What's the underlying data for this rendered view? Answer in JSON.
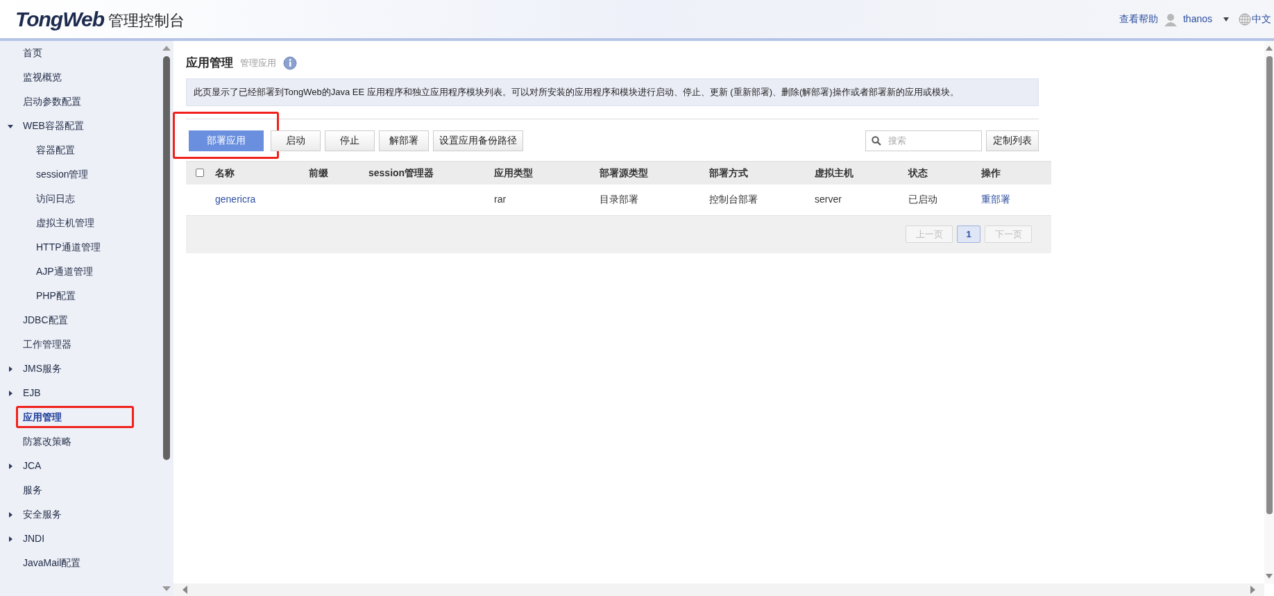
{
  "header": {
    "logo": "TongWeb",
    "title": "管理控制台",
    "help": "查看帮助",
    "user": "thanos",
    "language": "中文"
  },
  "sidebar": {
    "items": [
      {
        "label": "首页",
        "selected": false,
        "highlighted": false
      },
      {
        "label": "监视概览",
        "selected": false,
        "highlighted": false
      },
      {
        "label": "启动参数配置",
        "selected": false,
        "highlighted": false
      },
      {
        "label": "WEB容器配置",
        "selected": false,
        "highlighted": false,
        "expanded": true,
        "children": [
          {
            "label": "容器配置",
            "selected": false,
            "highlighted": false
          },
          {
            "label": "session管理",
            "selected": false,
            "highlighted": false
          },
          {
            "label": "访问日志",
            "selected": false,
            "highlighted": false
          },
          {
            "label": "虚拟主机管理",
            "selected": false,
            "highlighted": false
          },
          {
            "label": "HTTP通道管理",
            "selected": false,
            "highlighted": false
          },
          {
            "label": "AJP通道管理",
            "selected": false,
            "highlighted": false
          },
          {
            "label": "PHP配置",
            "selected": false,
            "highlighted": false
          }
        ]
      },
      {
        "label": "JDBC配置",
        "selected": false,
        "highlighted": false
      },
      {
        "label": "工作管理器",
        "selected": false,
        "highlighted": false
      },
      {
        "label": "JMS服务",
        "selected": false,
        "highlighted": false,
        "expanded": false
      },
      {
        "label": "EJB",
        "selected": false,
        "highlighted": false,
        "expanded": false
      },
      {
        "label": "应用管理",
        "selected": true,
        "highlighted": true
      },
      {
        "label": "防篡改策略",
        "selected": false,
        "highlighted": false
      },
      {
        "label": "JCA",
        "selected": false,
        "highlighted": false,
        "expanded": false
      },
      {
        "label": "服务",
        "selected": false,
        "highlighted": false
      },
      {
        "label": "安全服务",
        "selected": false,
        "highlighted": false,
        "expanded": false
      },
      {
        "label": "JNDI",
        "selected": false,
        "highlighted": false,
        "expanded": false
      },
      {
        "label": "JavaMail配置",
        "selected": false,
        "highlighted": false
      }
    ]
  },
  "page": {
    "title": "应用管理",
    "subtitle": "管理应用",
    "description": "此页显示了已经部署到TongWeb的Java EE 应用程序和独立应用程序模块列表。可以对所安装的应用程序和模块进行启动、停止、更新 (重新部署)、删除(解部署)操作或者部署新的应用或模块。"
  },
  "toolbar": {
    "buttons": [
      {
        "label": "部署应用",
        "kind": "primary",
        "highlighted": true
      },
      {
        "label": "启动",
        "kind": "default",
        "highlighted": false
      },
      {
        "label": "停止",
        "kind": "default",
        "highlighted": false
      },
      {
        "label": "解部署",
        "kind": "default",
        "highlighted": false
      },
      {
        "label": "设置应用备份路径",
        "kind": "default",
        "highlighted": false
      }
    ],
    "search": {
      "placeholder": "搜索"
    },
    "customize": "定制列表"
  },
  "table": {
    "select_all_checked": false,
    "columns": [
      "名称",
      "前缀",
      "session管理器",
      "应用类型",
      "部署源类型",
      "部署方式",
      "虚拟主机",
      "状态",
      "操作"
    ],
    "rows": [
      {
        "cells": [
          "genericra",
          "",
          "",
          "rar",
          "目录部署",
          "控制台部署",
          "server",
          "已启动",
          "重部署"
        ]
      }
    ]
  },
  "pagination": [
    {
      "label": "上一页",
      "kind": "nav",
      "disabled": true,
      "selected": false
    },
    {
      "label": "1",
      "kind": "page",
      "disabled": false,
      "selected": true
    },
    {
      "label": "下一页",
      "kind": "nav",
      "disabled": true,
      "selected": false
    }
  ]
}
